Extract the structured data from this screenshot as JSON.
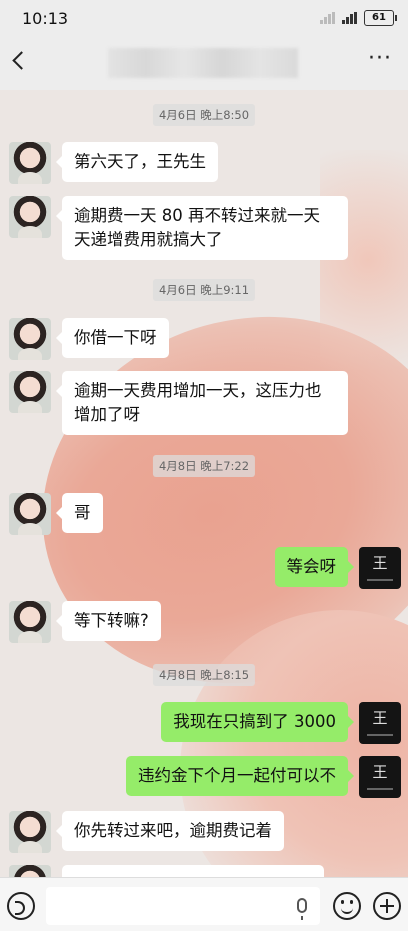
{
  "status_bar": {
    "time": "10:13",
    "battery": "61"
  },
  "nav": {
    "title": "",
    "more_label": "···"
  },
  "messages": [
    {
      "kind": "time",
      "text": "4月6日 晚上8:50"
    },
    {
      "kind": "msg",
      "side": "left",
      "text": "第六天了，王先生"
    },
    {
      "kind": "msg",
      "side": "left",
      "text": "逾期费一天 80 再不转过来就一天天递增费用就搞大了"
    },
    {
      "kind": "time",
      "text": "4月6日 晚上9:11"
    },
    {
      "kind": "msg",
      "side": "left",
      "text": "你借一下呀"
    },
    {
      "kind": "msg",
      "side": "left",
      "text": "逾期一天费用增加一天，这压力也增加了呀"
    },
    {
      "kind": "time",
      "text": "4月8日 晚上7:22"
    },
    {
      "kind": "msg",
      "side": "left",
      "text": "哥"
    },
    {
      "kind": "msg",
      "side": "right",
      "text": "等会呀"
    },
    {
      "kind": "msg",
      "side": "left",
      "text": "等下转嘛?"
    },
    {
      "kind": "time",
      "text": "4月8日 晚上8:15"
    },
    {
      "kind": "msg",
      "side": "right",
      "text": "我现在只搞到了 3000"
    },
    {
      "kind": "msg",
      "side": "right",
      "text": "违约金下个月一起付可以不"
    },
    {
      "kind": "msg",
      "side": "left",
      "text": "你先转过来吧，逾期费记着"
    }
  ],
  "avatars": {
    "right_glyph": "王"
  },
  "input": {
    "placeholder": ""
  },
  "colors": {
    "sent_bubble": "#95ec69",
    "received_bubble": "#ffffff",
    "chrome": "#ededed"
  }
}
